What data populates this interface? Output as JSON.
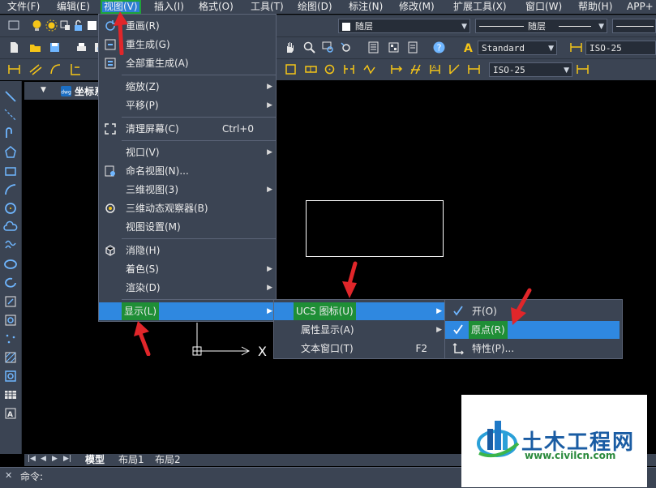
{
  "menubar": {
    "items": [
      "文件(F)",
      "编辑(E)",
      "视图(V)",
      "插入(I)",
      "格式(O)",
      "工具(T)",
      "绘图(D)",
      "标注(N)",
      "修改(M)",
      "扩展工具(X)",
      "窗口(W)",
      "帮助(H)",
      "APP+"
    ]
  },
  "toolbar": {
    "color_combo": "随层",
    "linetype_combo": "随层",
    "text_style_combo": "Standard",
    "dim_style_combo": "ISO-25",
    "dim_style_combo2": "ISO-25"
  },
  "drawing_tab": {
    "label": "坐标系"
  },
  "ucs": {
    "x_label": "X"
  },
  "view_menu": {
    "items": [
      {
        "label": "重画(R)"
      },
      {
        "label": "重生成(G)"
      },
      {
        "label": "全部重生成(A)"
      },
      {
        "label": "缩放(Z)"
      },
      {
        "label": "平移(P)"
      },
      {
        "label": "清理屏幕(C)",
        "shortcut": "Ctrl+0"
      },
      {
        "label": "视口(V)"
      },
      {
        "label": "命名视图(N)..."
      },
      {
        "label": "三维视图(3)"
      },
      {
        "label": "三维动态观察器(B)"
      },
      {
        "label": "视图设置(M)"
      },
      {
        "label": "消隐(H)"
      },
      {
        "label": "着色(S)"
      },
      {
        "label": "渲染(D)"
      },
      {
        "label": "显示(L)"
      }
    ]
  },
  "display_menu": {
    "items": [
      {
        "label": "UCS 图标(U)"
      },
      {
        "label": "属性显示(A)"
      },
      {
        "label": "文本窗口(T)",
        "shortcut": "F2"
      }
    ]
  },
  "ucs_menu": {
    "items": [
      {
        "label": "开(O)",
        "checked": true
      },
      {
        "label": "原点(R)",
        "checked": true
      },
      {
        "label": "特性(P)...",
        "checked": false
      }
    ]
  },
  "layout_tabs": [
    "模型",
    "布局1",
    "布局2"
  ],
  "command": {
    "prompt": "命令:"
  },
  "watermark": {
    "title": "土木工程网",
    "url": "www.civilcn.com"
  },
  "colors": {
    "highlight": "#2f88e0",
    "menu_bg": "#3b4453",
    "green_box": "#1f8e36",
    "arrow": "#e0262a"
  }
}
